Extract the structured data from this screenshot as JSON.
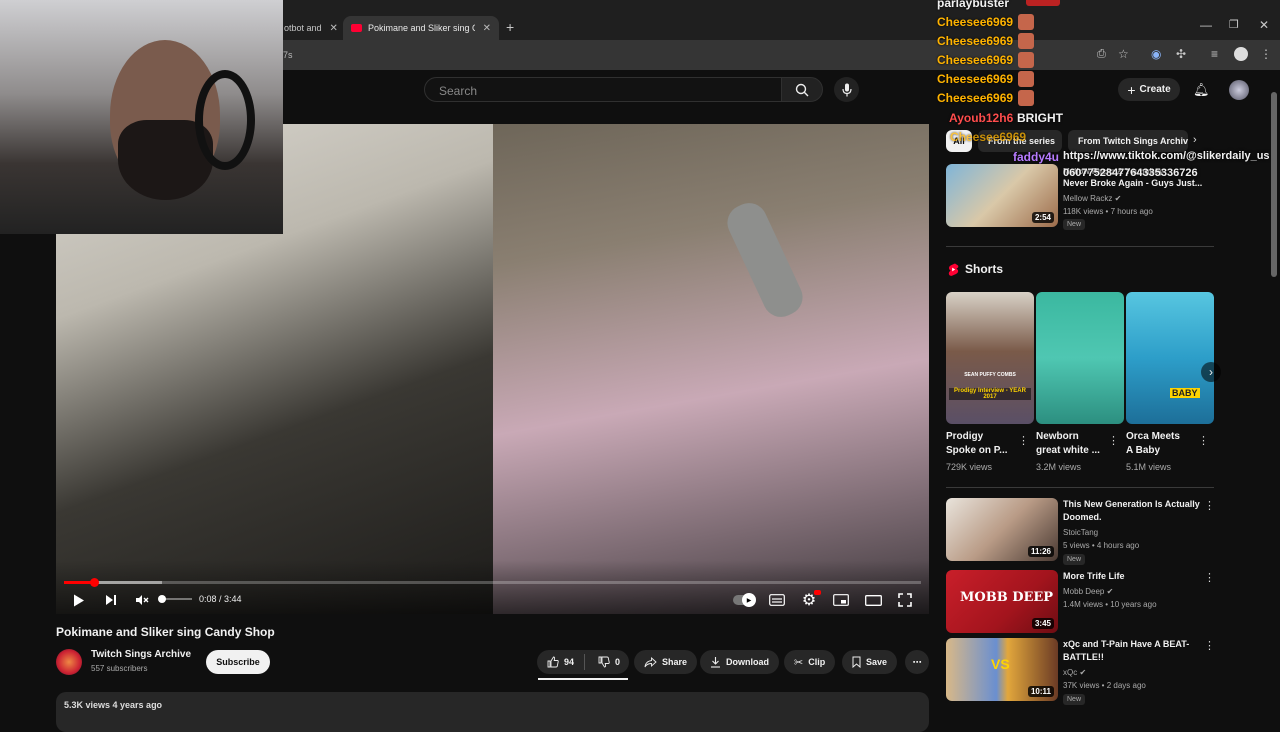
{
  "browser": {
    "tabs": [
      {
        "label": "otbot and",
        "active": false
      },
      {
        "label": "Pokimane and Sliker sing C",
        "active": true
      }
    ],
    "url_fragment": "7s"
  },
  "header": {
    "search_placeholder": "Search",
    "create_label": "Create"
  },
  "player": {
    "time": "0:08 / 3:44",
    "progress": 0.036,
    "buffered": 0.114,
    "volume": 0
  },
  "video": {
    "title": "Pokimane and Sliker sing Candy Shop",
    "channel": "Twitch Sings Archive",
    "subscribers": "557 subscribers",
    "subscribe_label": "Subscribe",
    "likes": "94",
    "dislikes": "0",
    "share_label": "Share",
    "download_label": "Download",
    "clip_label": "Clip",
    "save_label": "Save",
    "views_date": "5.3K views  4 years ago"
  },
  "chat": {
    "top_name": "parlaybuster",
    "lines": [
      {
        "name": "Cheesee6969"
      },
      {
        "name": "Cheesee6969"
      },
      {
        "name": "Cheesee6969"
      },
      {
        "name": "Cheesee6969"
      },
      {
        "name": "Cheesee6969"
      }
    ],
    "ayoub": {
      "name": "Ayoub12h6",
      "msg": "BRIGHT"
    },
    "faddy": {
      "name": "faddy4u",
      "msg": "https://www.tiktok.com/@slikerdaily_us"
    },
    "cheesee_faded": "Cheesee6969",
    "number_msg": "0607752847764335336726"
  },
  "chips": [
    {
      "label": "All",
      "active": true
    },
    {
      "label": "From the series",
      "active": false
    },
    {
      "label": "From Twitch Sings Archive",
      "active": false
    }
  ],
  "recommended_top": {
    "title_line1": "Mellow Rackz & Youngboy",
    "title_line2": "Never Broke Again - Guys Just...",
    "channel": "Mellow Rackz",
    "meta": "118K views • 7 hours ago",
    "badge": "New",
    "duration": "2:54"
  },
  "shorts": {
    "heading": "Shorts",
    "items": [
      {
        "title_line1": "Prodigy",
        "title_line2": "Spoke on P...",
        "views": "729K views",
        "thumb_text": "SEAN PUFFY COMBS",
        "thumb_sub": "Prodigy Interview - YEAR 2017"
      },
      {
        "title_line1": "Newborn",
        "title_line2": "great white ...",
        "views": "3.2M views"
      },
      {
        "title_line1": "Orca Meets",
        "title_line2": "A Baby",
        "views": "5.1M views",
        "thumb_text": "BABY"
      }
    ]
  },
  "recommended": [
    {
      "title_line1": "This New Generation Is Actually",
      "title_line2": "Doomed.",
      "channel": "StoicTang",
      "meta": "5 views • 4 hours ago",
      "badge": "New",
      "duration": "11:26"
    },
    {
      "title_line1": "More Trife Life",
      "title_line2": "",
      "channel": "Mobb Deep",
      "meta": "1.4M views • 10 years ago",
      "badge": "",
      "duration": "3:45",
      "thumb_text": "MOBB DEEP"
    },
    {
      "title_line1": "xQc and T-Pain Have A BEAT-",
      "title_line2": "BATTLE!!",
      "channel": "xQc",
      "meta": "37K views • 2 days ago",
      "badge": "New",
      "duration": "10:11",
      "thumb_text": "VS"
    }
  ],
  "colors": {
    "accent": "#ff0000",
    "chat_name": "#ffb300",
    "chat_ayoub": "#ff4d4d",
    "background": "#0f0f0f"
  }
}
